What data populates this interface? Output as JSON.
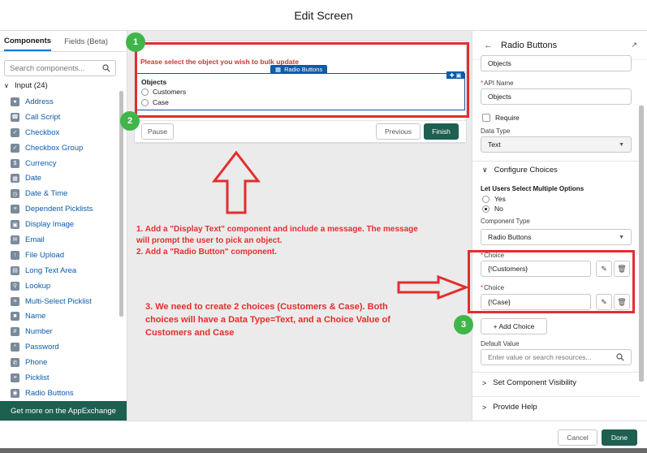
{
  "header": {
    "title": "Edit Screen"
  },
  "left_panel": {
    "tabs": [
      {
        "label": "Components"
      },
      {
        "label": "Fields (Beta)"
      }
    ],
    "search": {
      "placeholder": "Search components..."
    },
    "section": {
      "label": "Input (24)"
    },
    "components": [
      {
        "label": "Address",
        "icon": "address-icon"
      },
      {
        "label": "Call Script",
        "icon": "call-script-icon"
      },
      {
        "label": "Checkbox",
        "icon": "checkbox-icon"
      },
      {
        "label": "Checkbox Group",
        "icon": "checkbox-group-icon"
      },
      {
        "label": "Currency",
        "icon": "currency-icon"
      },
      {
        "label": "Date",
        "icon": "date-icon"
      },
      {
        "label": "Date & Time",
        "icon": "date-time-icon"
      },
      {
        "label": "Dependent Picklists",
        "icon": "dependent-picklists-icon"
      },
      {
        "label": "Display Image",
        "icon": "display-image-icon"
      },
      {
        "label": "Email",
        "icon": "email-icon"
      },
      {
        "label": "File Upload",
        "icon": "file-upload-icon"
      },
      {
        "label": "Long Text Area",
        "icon": "long-text-area-icon"
      },
      {
        "label": "Lookup",
        "icon": "lookup-icon"
      },
      {
        "label": "Multi-Select Picklist",
        "icon": "multi-select-picklist-icon"
      },
      {
        "label": "Name",
        "icon": "name-icon"
      },
      {
        "label": "Number",
        "icon": "number-icon"
      },
      {
        "label": "Password",
        "icon": "password-icon"
      },
      {
        "label": "Phone",
        "icon": "phone-icon"
      },
      {
        "label": "Picklist",
        "icon": "picklist-icon"
      },
      {
        "label": "Radio Buttons",
        "icon": "radio-buttons-icon"
      }
    ],
    "appexchange_label": "Get more on the AppExchange"
  },
  "canvas": {
    "display_text": "Please select the object you wish to bulk update",
    "radio_tag": "Radio Buttons",
    "radio_group": {
      "label": "Objects",
      "options": [
        "Customers",
        "Case"
      ]
    },
    "buttons": {
      "pause": "Pause",
      "previous": "Previous",
      "finish": "Finish"
    },
    "badges": [
      "1",
      "2",
      "3"
    ],
    "annotation_1": [
      "1. Add a \"Display Text\" component and include a message. The message",
      "will prompt the user to pick an object.",
      "2. Add a \"Radio Button\" component."
    ],
    "annotation_2": [
      "3. We need to create 2 choices (Customers & Case). Both",
      "choices will have a Data Type=Text, and a Choice Value of",
      "Customers and Case"
    ]
  },
  "right_panel": {
    "title": "Radio Buttons",
    "label_value": "Objects",
    "api_name_label": "API Name",
    "api_name_value": "Objects",
    "require_label": "Require",
    "data_type_label": "Data Type",
    "data_type_value": "Text",
    "configure_choices_label": "Configure Choices",
    "multi_select_label": "Let Users Select Multiple Options",
    "multi_yes": "Yes",
    "multi_no": "No",
    "component_type_label": "Component Type",
    "component_type_value": "Radio Buttons",
    "choices": [
      {
        "label": "Choice",
        "value": "{!Customers}"
      },
      {
        "label": "Choice",
        "value": "{!Case}"
      }
    ],
    "add_choice_label": "+ Add Choice",
    "default_value_label": "Default Value",
    "default_value_placeholder": "Enter value or search resources...",
    "visibility_label": "Set Component Visibility",
    "help_label": "Provide Help"
  },
  "footer": {
    "cancel": "Cancel",
    "done": "Done"
  },
  "colors": {
    "accent": "#1d5f50",
    "annotation": "#e32e2e",
    "badge": "#3fb54a",
    "link": "#0b5cab"
  }
}
